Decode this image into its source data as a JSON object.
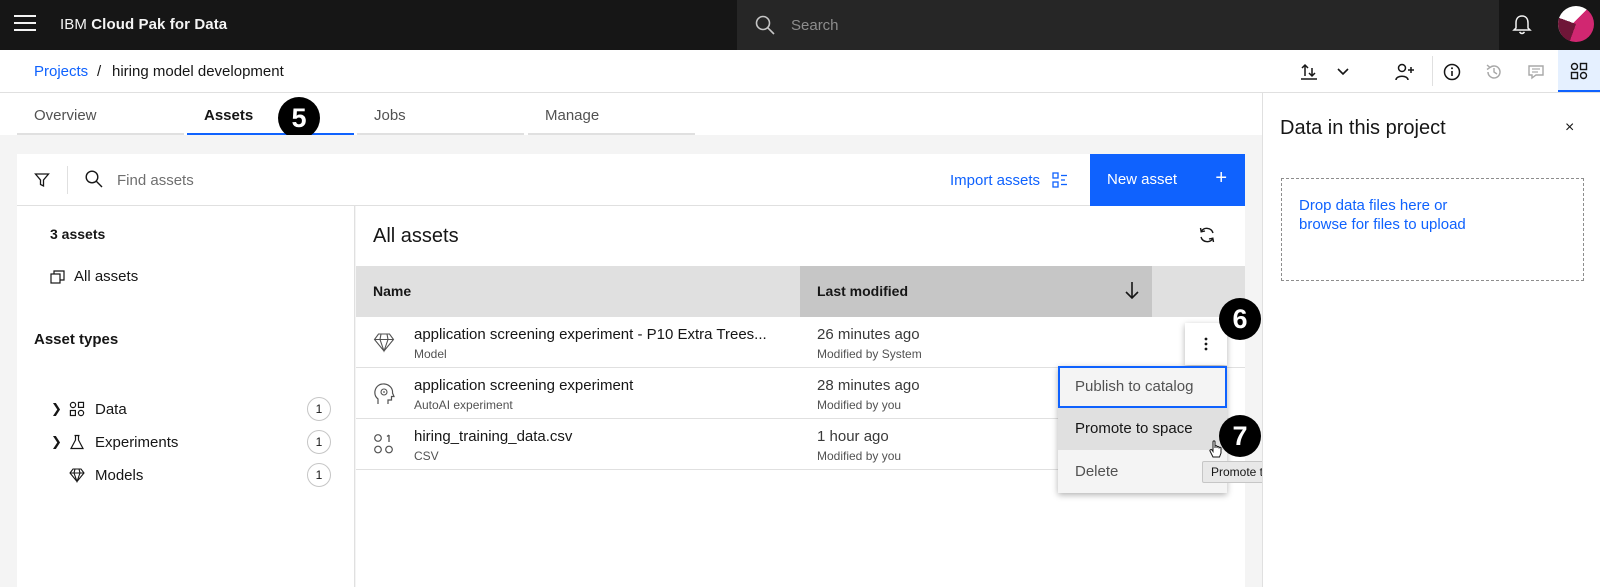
{
  "header": {
    "brand_prefix": "IBM",
    "brand_product": "Cloud Pak for Data",
    "search_placeholder": "Search"
  },
  "breadcrumb": {
    "root": "Projects",
    "separator": "/",
    "current": "hiring model development"
  },
  "tabs": [
    {
      "label": "Overview"
    },
    {
      "label": "Assets"
    },
    {
      "label": "Jobs"
    },
    {
      "label": "Manage"
    }
  ],
  "toolbar": {
    "find_placeholder": "Find assets",
    "import_label": "Import assets",
    "new_asset_label": "New asset"
  },
  "sidebar": {
    "count_label": "3 assets",
    "all_assets_label": "All assets",
    "types_title": "Asset types",
    "types": [
      {
        "label": "Data",
        "count": "1",
        "icon": "data-icon"
      },
      {
        "label": "Experiments",
        "count": "1",
        "icon": "flask-icon"
      },
      {
        "label": "Models",
        "count": "1",
        "icon": "diamond-icon"
      }
    ]
  },
  "main": {
    "title": "All assets",
    "columns": {
      "name": "Name",
      "last_modified": "Last modified"
    },
    "rows": [
      {
        "name": "application screening experiment - P10 Extra Trees...",
        "type": "Model",
        "time": "26 minutes ago",
        "by": "Modified by System",
        "icon": "diamond-icon"
      },
      {
        "name": "application screening experiment",
        "type": "AutoAI experiment",
        "time": "28 minutes ago",
        "by": "Modified by you",
        "icon": "autoai-head-icon"
      },
      {
        "name": "hiring_training_data.csv",
        "type": "CSV",
        "time": "1 hour ago",
        "by": "Modified by you",
        "icon": "data-icon"
      }
    ]
  },
  "menu": {
    "items": [
      {
        "label": "Publish to catalog"
      },
      {
        "label": "Promote to space"
      },
      {
        "label": "Delete"
      }
    ],
    "tooltip": "Promote to space"
  },
  "steps": {
    "five": "5",
    "six": "6",
    "seven": "7"
  },
  "right_panel": {
    "title": "Data in this project",
    "close": "×",
    "drop_line1": "Drop data files here or",
    "drop_line2": "browse for files to upload"
  },
  "colors": {
    "accent": "#0f62fe",
    "header_bg": "#161616",
    "panel_bg": "#f4f4f4"
  }
}
